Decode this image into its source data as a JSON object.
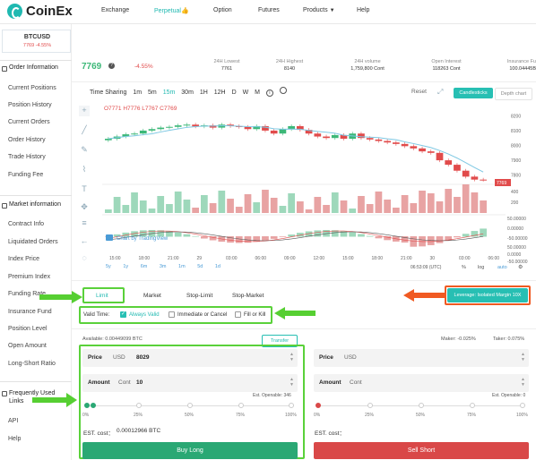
{
  "nav": {
    "logo": "CoinEx",
    "items": [
      "Exchange",
      "Perpetual👍",
      "Option",
      "Futures",
      "Products",
      "Help"
    ],
    "products_caret": "▼"
  },
  "ticker": {
    "symbol": "BTCUSD",
    "price": "7769",
    "change": "-4.55%"
  },
  "sidebar": {
    "order_header": "Order Information",
    "order_items": [
      "Current Positions",
      "Position History",
      "Current Orders",
      "Order History",
      "Trade History",
      "Funding Fee"
    ],
    "market_header": "Market information",
    "market_items": [
      "Contract Info",
      "Liquidated Orders",
      "Index Price",
      "Premium Index",
      "Funding Rate",
      "Insurance Fund",
      "Position Level",
      "Open Amount",
      "Long-Short Ratio"
    ],
    "links_header": "Frequently Used Links",
    "links_items": [
      "API",
      "Help"
    ]
  },
  "market": {
    "last_price": "7769",
    "info_icon": "info-icon",
    "change": "-4.55%",
    "stats": [
      {
        "label": "24H Lowest",
        "value": "7761"
      },
      {
        "label": "24H Highest",
        "value": "8140"
      },
      {
        "label": "24H volume",
        "value": "1,759,800 Cont"
      },
      {
        "label": "Open Interest",
        "value": "118263 Cont"
      },
      {
        "label": "Insurance Fu",
        "value": "100.04445B"
      }
    ]
  },
  "chart": {
    "toolbar": [
      "Time Sharing",
      "1m",
      "5m",
      "15m",
      "30m",
      "1H",
      "12H",
      "D",
      "W",
      "M"
    ],
    "reset": "Reset",
    "candlesticks": "Candlesticks",
    "depth": "Depth chart",
    "ohlc": "O7771 H7776 L7767 C7769",
    "price_ticks": [
      "8200",
      "8100",
      "8000",
      "7900",
      "7800"
    ],
    "current_price": "7769",
    "vol_ticks": [
      "400",
      "200"
    ],
    "macd_ticks": [
      "50.00000",
      "0.00000",
      "-50.00000"
    ],
    "macd_ticks2": [
      "50.00000",
      "0.0000",
      "-50.00000"
    ],
    "time_ticks": [
      "15:00",
      "18:00",
      "21:00",
      "29",
      "03:00",
      "06:00",
      "09:00",
      "12:00",
      "15:00",
      "18:00",
      "21:00",
      "30",
      "03:00",
      "06:00"
    ],
    "watermark": "Chart by TradingView",
    "ranges": [
      "5y",
      "1y",
      "6m",
      "3m",
      "1m",
      "5d",
      "1d"
    ],
    "clock": "06:53:09 (UTC)",
    "pct": "%",
    "log": "log",
    "auto": "auto",
    "series": {
      "close": [
        8045,
        8060,
        8075,
        8080,
        8100,
        8110,
        8120,
        8125,
        8135,
        8140,
        8128,
        8135,
        8120,
        8140,
        8130,
        8125,
        8110,
        8130,
        8100,
        8080,
        8110,
        8130,
        8105,
        8080,
        8060,
        8050,
        8070,
        8045,
        8080,
        8050,
        8040,
        8030,
        8020,
        8010,
        7995,
        7980,
        7960,
        7950,
        7900,
        7870,
        7830,
        7790,
        7770,
        7769
      ]
    }
  },
  "order": {
    "tabs": [
      "Limit",
      "Market",
      "Stop-Limit",
      "Stop-Market"
    ],
    "leverage": "Leverage: Isolated Margin 10X",
    "valid_time": "Valid Time:",
    "opt_always": "Always Valid",
    "opt_ioc": "Immediate or Cancel",
    "opt_fok": "Fill or Kill",
    "available": "Available: 0.00449099 BTC",
    "transfer": "Transfer",
    "maker": "Maker: -0.025%",
    "taker": "Taker: 0.075%",
    "long": {
      "price_label": "Price",
      "price_unit": "USD",
      "price_value": "8029",
      "amount_label": "Amount",
      "amount_unit": "Cont",
      "amount_value": "10",
      "est_openable": "Est. Openable: 346",
      "cost_label": "EST. cost：",
      "cost_value": "0.00012966 BTC",
      "button": "Buy Long"
    },
    "short": {
      "price_label": "Price",
      "price_unit": "USD",
      "amount_label": "Amount",
      "amount_unit": "Cont",
      "est_openable": "Est. Openable: 0",
      "cost_label": "EST. cost：",
      "button": "Sell Short"
    },
    "slider_marks": [
      "0%",
      "25%",
      "50%",
      "75%",
      "100%"
    ],
    "long_slider_fraction": 0.0,
    "short_slider_fraction": 0.0
  },
  "colors": {
    "accent": "#20b9b1",
    "up": "#3cb878",
    "down": "#e14b4b",
    "highlight": "#5ad13a",
    "leverage_bg": "#27bfb3",
    "leverage_border": "#f05a22",
    "buy": "#2aa874",
    "sell": "#d94848"
  }
}
